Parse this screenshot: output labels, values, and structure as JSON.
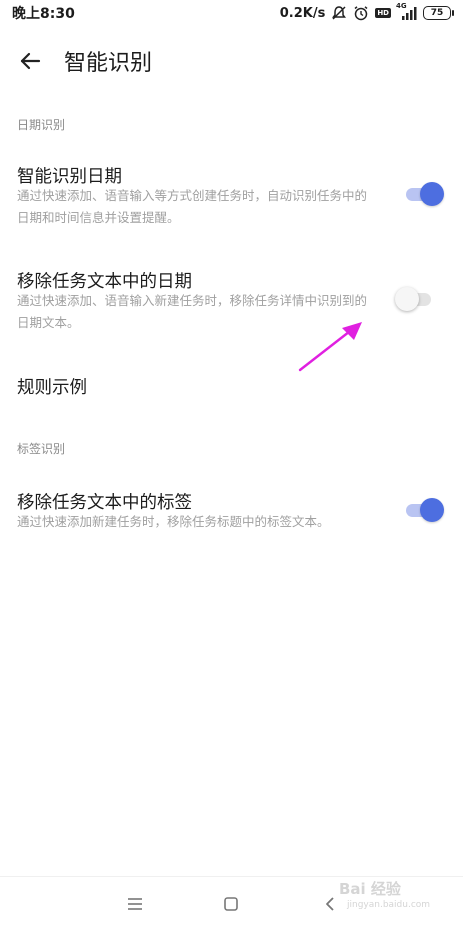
{
  "status_bar": {
    "time": "晚上8:30",
    "network_speed": "0.2K/s",
    "network_type": "4G",
    "hd_label": "HD",
    "battery": "75"
  },
  "header": {
    "title": "智能识别"
  },
  "sections": {
    "date": {
      "label": "日期识别",
      "smart_date": {
        "title": "智能识别日期",
        "description": "通过快速添加、语音输入等方式创建任务时，自动识别任务中的日期和时间信息并设置提醒。",
        "enabled": true
      },
      "remove_date": {
        "title": "移除任务文本中的日期",
        "description": "通过快速添加、语音输入新建任务时，移除任务详情中识别到的日期文本。",
        "enabled": false
      },
      "rule_examples": {
        "title": "规则示例"
      }
    },
    "tag": {
      "label": "标签识别",
      "remove_tag": {
        "title": "移除任务文本中的标签",
        "description": "通过快速添加新建任务时，移除任务标题中的标签文本。",
        "enabled": true
      }
    }
  },
  "colors": {
    "accent": "#4d6ee0",
    "annotation_arrow": "#e020e0"
  },
  "watermark": {
    "text": "Bai 经验",
    "sub": "jingyan.baidu.com"
  }
}
